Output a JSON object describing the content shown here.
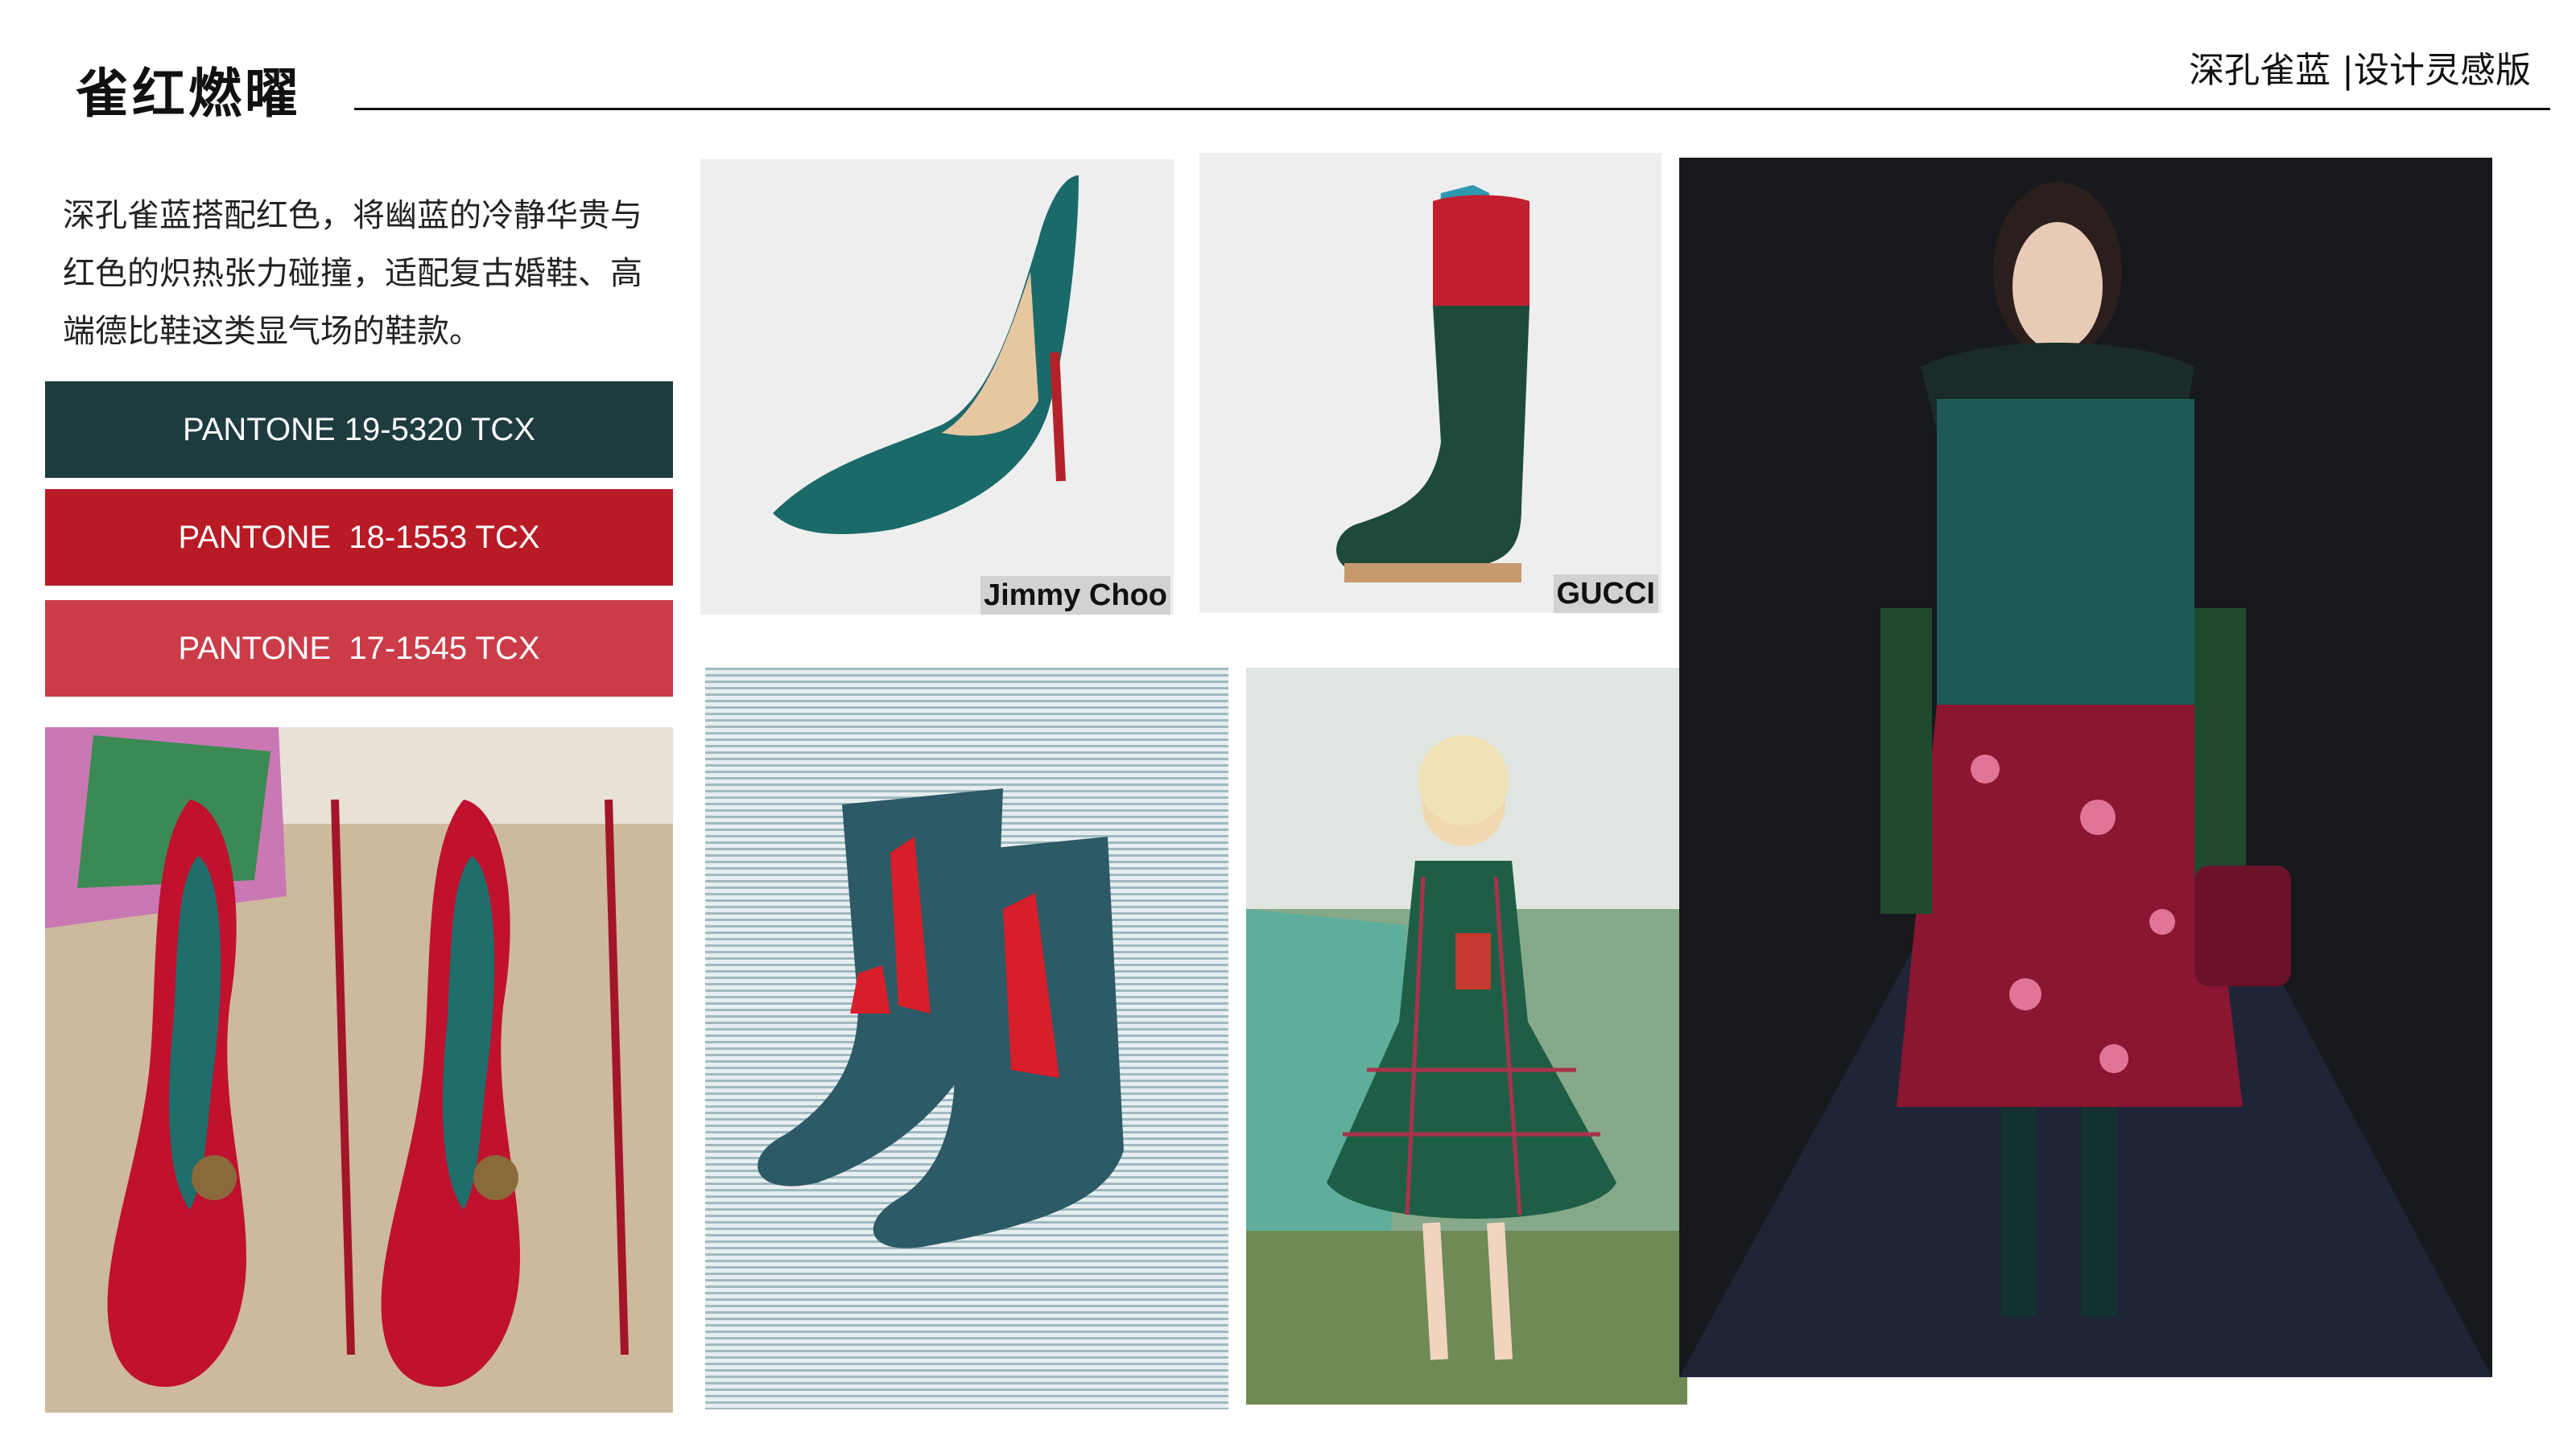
{
  "header": {
    "title": "雀红燃曜",
    "right_title": "深孔雀蓝 |设计灵感版"
  },
  "description": {
    "lines": [
      "深孔雀蓝搭配红色，将幽蓝的冷静华贵与",
      "红色的炽热张力碰撞，适配复古婚鞋、高",
      "端德比鞋这类显气场的鞋款。"
    ]
  },
  "swatches": [
    {
      "label": "PANTONE 19-5320 TCX",
      "color": "#1e3c3e"
    },
    {
      "label": "PANTONE  18-1553 TCX",
      "color": "#b81b26"
    },
    {
      "label": "PANTONE  17-1545 TCX",
      "color": "#cb3c48"
    }
  ],
  "images": {
    "pump_brand": "Jimmy Choo",
    "boot_brand": "GUCCI"
  },
  "colors": {
    "peacock": "#1a5b5e",
    "deep_green": "#1d4b3b",
    "red": "#b81b26",
    "pink_red": "#cb3c48",
    "burgundy": "#8a1631"
  }
}
